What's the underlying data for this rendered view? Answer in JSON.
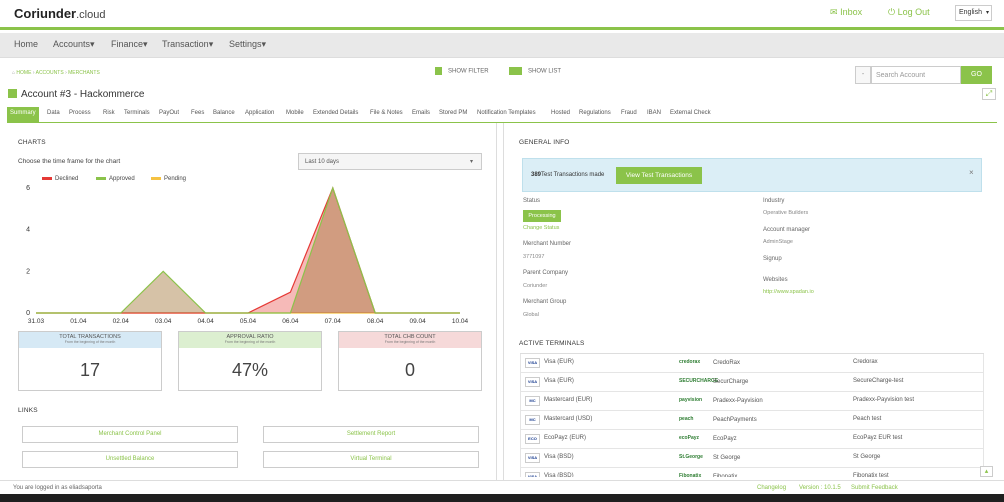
{
  "app": {
    "logo_main": "Coriunder",
    "logo_suffix": ".cloud"
  },
  "top": {
    "inbox": "Inbox",
    "logout": "Log Out",
    "language": "English"
  },
  "nav": [
    "Home",
    "Accounts",
    "Finance",
    "Transaction",
    "Settings"
  ],
  "breadcrumb": [
    "HOME",
    "ACCOUNTS",
    "MERCHANTS"
  ],
  "filter": {
    "show_filter": "SHOW FILTER",
    "show_list": "SHOW LIST"
  },
  "search": {
    "minus": "-",
    "placeholder": "Search Account",
    "go": "GO"
  },
  "account_title": "Account #3 - Hackommerce",
  "tabs": [
    "Summary",
    "Data",
    "Process",
    "Risk",
    "Terminals",
    "PayOut",
    "Fees",
    "Balance",
    "Application",
    "Mobile",
    "Extended Details",
    "File & Notes",
    "Emails",
    "Stored PM",
    "Notification Templates",
    "Hosted",
    "Regulations",
    "Fraud",
    "IBAN",
    "External Check"
  ],
  "charts": {
    "heading": "CHARTS",
    "timeframe_label": "Choose the time frame for the chart",
    "timeframe_value": "Last 10 days"
  },
  "chart_data": {
    "type": "area",
    "categories": [
      "31.03",
      "01.04",
      "02.04",
      "03.04",
      "04.04",
      "05.04",
      "06.04",
      "07.04",
      "08.04",
      "09.04",
      "10.04"
    ],
    "ylim": [
      0,
      6
    ],
    "yticks": [
      "0",
      "2",
      "4",
      "6"
    ],
    "series": [
      {
        "name": "Declined",
        "color": "#e53935",
        "values": [
          0,
          0,
          0,
          0,
          0,
          0,
          1,
          6,
          0,
          0,
          0
        ]
      },
      {
        "name": "Approved",
        "color": "#8bc34a",
        "values": [
          0,
          0,
          0,
          2,
          0,
          0,
          0,
          6,
          0,
          0,
          0
        ]
      },
      {
        "name": "Pending",
        "color": "#f5c242",
        "values": [
          0,
          0,
          0,
          0,
          0,
          0,
          0,
          0,
          0,
          0,
          0
        ]
      }
    ],
    "legend": "top-left"
  },
  "cards": [
    {
      "title": "TOTAL TRANSACTIONS",
      "sub": "From the beginning of the month",
      "value": "17",
      "color": "#d6e9f5"
    },
    {
      "title": "APPROVAL RATIO",
      "sub": "From the beginning of the month",
      "value": "47%",
      "color": "#dcefd0"
    },
    {
      "title": "TOTAL CHB COUNT",
      "sub": "From the beginning of the month",
      "value": "0",
      "color": "#f6d9d9"
    }
  ],
  "links": {
    "heading": "LINKS",
    "items": [
      "Merchant Control Panel",
      "Settlement Report",
      "Unsettled Balance",
      "Virtual Terminal"
    ]
  },
  "general": {
    "heading": "GENERAL INFO",
    "test_count": "389",
    "test_text": "Test Transactions made",
    "test_button": "View Test Transactions",
    "close": "×",
    "status_label": "Status",
    "status_value": "Processing",
    "change_status": "Change Status",
    "merchant_number_label": "Merchant Number",
    "merchant_number": "3771097",
    "parent_company_label": "Parent Company",
    "parent_company": "Coriunder",
    "merchant_group_label": "Merchant Group",
    "merchant_group": "Global",
    "industry_label": "Industry",
    "industry": "Operative Builders",
    "account_manager_label": "Account manager",
    "account_manager": "AdminStage",
    "signup_label": "Signup",
    "websites_label": "Websites",
    "website": "http://www.spadan.io"
  },
  "terminals": {
    "heading": "ACTIVE TERMINALS",
    "rows": [
      {
        "icon": "VISA",
        "brand": "Visa (EUR)",
        "logo": "credorax",
        "processor": "CredoRax",
        "terminal": "Credorax"
      },
      {
        "icon": "VISA",
        "brand": "Visa (EUR)",
        "logo": "SECURCHARGE",
        "processor": "SecurCharge",
        "terminal": "SecureCharge-test"
      },
      {
        "icon": "MC",
        "brand": "Mastercard (EUR)",
        "logo": "payvision",
        "processor": "Pradexx-Payvision",
        "terminal": "Pradexx-Payvision test"
      },
      {
        "icon": "MC",
        "brand": "Mastercard (USD)",
        "logo": "peach",
        "processor": "PeachPayments",
        "terminal": "Peach test"
      },
      {
        "icon": "ECO",
        "brand": "EcoPayz (EUR)",
        "logo": "ecoPayz",
        "processor": "EcoPayz",
        "terminal": "EcoPayz EUR test"
      },
      {
        "icon": "VISA",
        "brand": "Visa (BSD)",
        "logo": "St.George",
        "processor": "St George",
        "terminal": "St George"
      },
      {
        "icon": "VISA",
        "brand": "Visa (BSD)",
        "logo": "Fibonatix",
        "processor": "Fibonatix",
        "terminal": "Fibonatix test"
      }
    ]
  },
  "footer": {
    "logged_in": "You are logged in as eliadsaporta",
    "changelog": "Changelog",
    "version": "Version : 10.1.5",
    "feedback": "Submit Feedback"
  }
}
